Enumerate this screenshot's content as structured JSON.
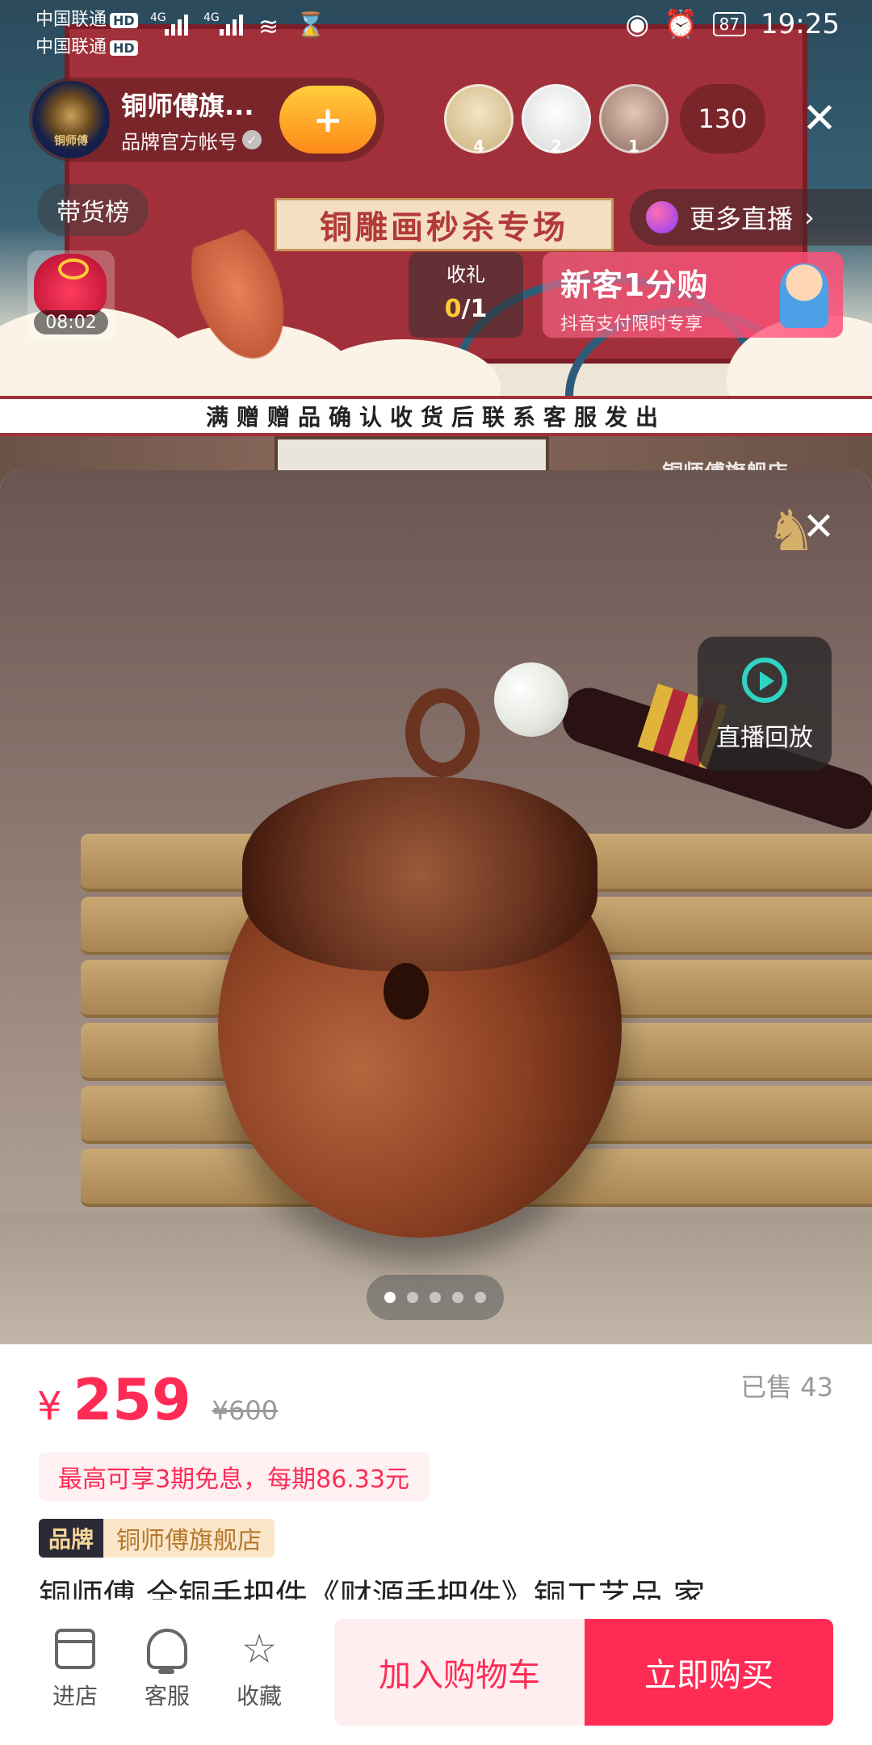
{
  "status_bar": {
    "carrier1": "中国联通",
    "carrier2": "中国联通",
    "hd1": "HD",
    "hd2": "HD",
    "net1": "4G",
    "net2": "4G",
    "battery": "87",
    "time": "19:25"
  },
  "live": {
    "anchor_name": "铜师傅旗...",
    "anchor_subtitle": "品牌官方帐号",
    "follow_icon": "+",
    "viewers": [
      {
        "rank": "4"
      },
      {
        "rank": "2"
      },
      {
        "rank": "1"
      }
    ],
    "viewer_count": "130",
    "rank_label": "带货榜",
    "more_live_label": "更多直播",
    "gift_timer": "08:02",
    "receive_gift_label": "收礼",
    "receive_gift_current": "0",
    "receive_gift_total": "/1",
    "newbie_title": "新客1分购",
    "newbie_subtitle": "抖音支付限时专享",
    "promo_title": "铜雕画秒杀专场",
    "gift_notice": "满赠赠品确认收货后联系客服发出",
    "studio_text": "铜师傅旗舰店"
  },
  "product": {
    "replay_label": "直播回放",
    "image_count": 5,
    "active_image": 0,
    "currency": "¥",
    "price": "259",
    "original_price": "¥600",
    "sold": "已售 43",
    "installment": "最高可享3期免息，每期86.33元",
    "brand_tag": "品牌",
    "brand_store": "铜师傅旗舰店",
    "title": "铜师傅 全铜手把件《财源手把件》铜工艺品 家"
  },
  "bottom_bar": {
    "store_label": "进店",
    "service_label": "客服",
    "favorite_label": "收藏",
    "cart_label": "加入购物车",
    "buy_label": "立即购买"
  },
  "colors": {
    "accent": "#fe2c55",
    "brand_gold": "#f7d69a",
    "replay_teal": "#2fd3c4"
  }
}
